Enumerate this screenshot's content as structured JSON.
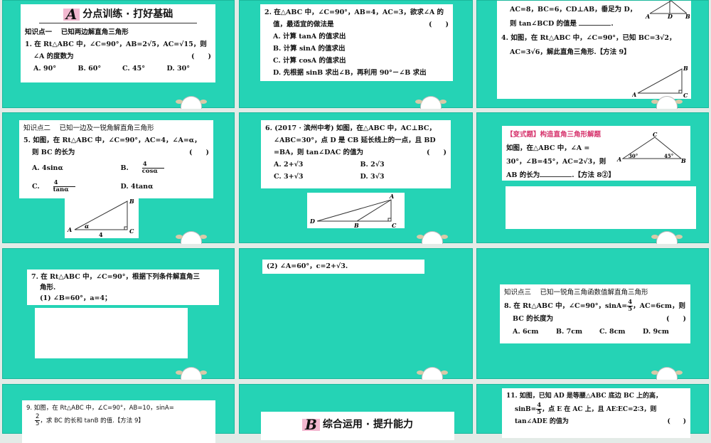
{
  "s1": {
    "badge": "A",
    "title": "分点训练 · 打好基础",
    "kp": "知识点一　 已知两边解直角三角形",
    "q": "1. 在 Rt△ABC 中，∠C=90°，AB=2√5，AC=√15，则",
    "q2": "∠A 的度数为",
    "paren": "(　　)",
    "opts": [
      "A. 90°",
      "B. 60°",
      "C. 45°",
      "D. 30°"
    ]
  },
  "s2": {
    "q": "2. 在△ABC 中，∠C=90°，AB=4，AC=3，欲求∠A 的",
    "q2": "值，最适宜的做法是",
    "paren": "(　　)",
    "opts": [
      "A. 计算 tanA 的值求出",
      "B. 计算 sinA 的值求出",
      "C. 计算 cosA 的值求出",
      "D. 先根据 sinB 求出∠B，再利用 90°－∠B 求出"
    ]
  },
  "s3": {
    "l1": "AC=8，BC=6，CD⊥AB，垂足为 D，",
    "l2": "则 tan∠BCD 的值是",
    "l2end": ".",
    "q4": "4. 如图，在 Rt△ABC 中，∠C=90°，已知 BC=3√2，",
    "q4b": "AC=3√6，解此直角三角形.【方法 9】",
    "fig1": [
      "A",
      "D",
      "B"
    ],
    "fig2": [
      "A",
      "B",
      "C"
    ]
  },
  "s4": {
    "kp": "知识点二　 已知一边及一锐角解直角三角形",
    "q": "5. 如图，在 Rt△ABC 中，∠C=90°，AC=4，∠A=α，",
    "q2": "则 BC 的长为",
    "paren": "(　　)",
    "optA": "A. 4sinα",
    "optB": "B.",
    "optBn": "4",
    "optBd": "cosα",
    "optC": "C.",
    "optCn": "4",
    "optCd": "tanα",
    "optD": "D. 4tanα",
    "fig": [
      "A",
      "B",
      "C",
      "α",
      "4"
    ]
  },
  "s5": {
    "q": "6. (2017 · 滨州中考) 如图，在△ABC 中，AC⊥BC，",
    "q2": "∠ABC=30°，点 D 是 CB 延长线上的一点，且 BD",
    "q3": "=BA，则 tan∠DAC 的值为",
    "paren": "(　　)",
    "opts": [
      "A. 2+√3",
      "B. 2√3",
      "C. 3+√3",
      "D. 3√3"
    ],
    "fig": [
      "A",
      "B",
      "C",
      "D"
    ]
  },
  "s6": {
    "tag": "【变式题】构造直角三角形解题",
    "l1": "如图，在△ABC 中，∠A =",
    "l2": "30°，∠B=45°，AC=2√3，则",
    "l3": "AB 的长为",
    "l3end": ".【方法 8②】",
    "fig": [
      "A",
      "B",
      "C",
      "30°",
      "45°"
    ]
  },
  "s7": {
    "q": "7. 在 Rt△ABC 中，∠C=90°，根据下列条件解直角三",
    "q2": "角形.",
    "q3": "(1) ∠B=60°，a=4；"
  },
  "s8": {
    "q": "(2) ∠A=60°，c=2+√3."
  },
  "s9": {
    "kp": "知识点三　 已知一锐角三角函数值解直角三角形",
    "q": "8. 在 Rt△ABC 中，∠C=90°，sinA=",
    "qn": "4",
    "qd": "5",
    "qend": "，AC=6cm，则",
    "q2": "BC 的长度为",
    "paren": "(　　)",
    "opts": [
      "A. 6cm",
      "B. 7cm",
      "C. 8cm",
      "D. 9cm"
    ]
  },
  "s10": {
    "q": "9. 如图，在 Rt△ABC 中，∠C=90°，AB=10，sinA=",
    "qn": "2",
    "qd": "5",
    "q2": "，求 BC 的长和 tanB 的值.【方法 9】"
  },
  "s11": {
    "badge": "B",
    "title": "综合运用 · 提升能力"
  },
  "s12": {
    "q": "11. 如图，已知 AD 是等腰△ABC 底边 BC 上的高，",
    "q2a": "sinB=",
    "qn": "4",
    "qd": "5",
    "q2b": "，点 E 在 AC 上，且 AE∶EC=2∶3，则",
    "q3": "tan∠ADE 的值为",
    "paren": "(　　)"
  }
}
